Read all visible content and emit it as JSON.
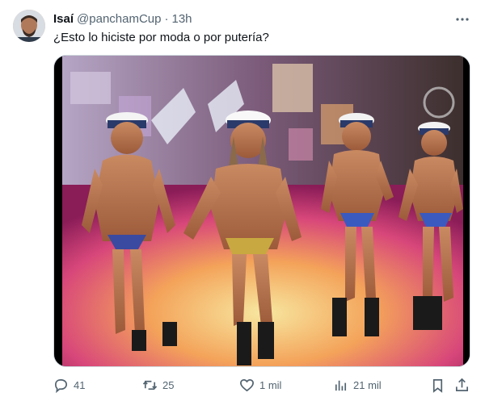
{
  "tweet": {
    "author": {
      "name": "Isaí",
      "handle": "@panchamCup",
      "separator": "·",
      "time": "13h"
    },
    "text": "¿Esto lo hiciste por moda o por putería?",
    "media": {
      "alt": "Cuatro bailarines con gorras de marinero en un escenario"
    }
  },
  "actions": {
    "reply": {
      "icon": "reply-icon",
      "count": "41"
    },
    "retweet": {
      "icon": "retweet-icon",
      "count": "25"
    },
    "like": {
      "icon": "heart-icon",
      "count": "1 mil"
    },
    "views": {
      "icon": "views-icon",
      "count": "21 mil"
    },
    "bookmark": {
      "icon": "bookmark-icon"
    },
    "share": {
      "icon": "share-icon"
    }
  },
  "colors": {
    "text_primary": "#0f1419",
    "text_secondary": "#536471",
    "border": "#cfd9de"
  }
}
